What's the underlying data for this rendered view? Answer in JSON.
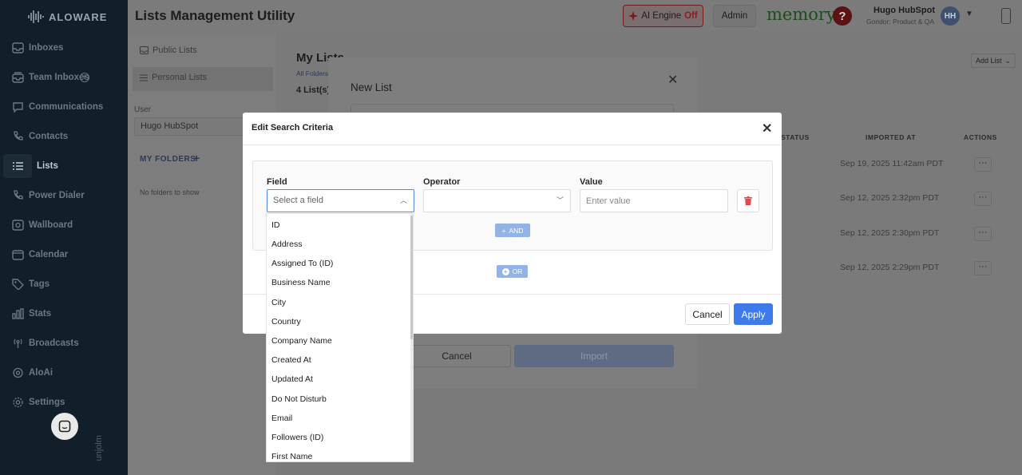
{
  "sidebar": {
    "logo": "ALOWARE",
    "items": [
      {
        "label": "Inboxes",
        "icon": "inbox-icon"
      },
      {
        "label": "Team Inboxes",
        "icon": "team-inbox-icon"
      },
      {
        "label": "Communications",
        "icon": "communications-icon"
      },
      {
        "label": "Contacts",
        "icon": "contacts-icon"
      },
      {
        "label": "Lists",
        "icon": "list-icon"
      },
      {
        "label": "Power Dialer",
        "icon": "power-dialer-icon"
      },
      {
        "label": "Wallboard",
        "icon": "wallboard-icon"
      },
      {
        "label": "Calendar",
        "icon": "calendar-icon"
      },
      {
        "label": "Tags",
        "icon": "tag-icon"
      },
      {
        "label": "Stats",
        "icon": "stats-icon"
      },
      {
        "label": "Broadcasts",
        "icon": "broadcast-icon"
      },
      {
        "label": "AloAi",
        "icon": "aloai-icon"
      },
      {
        "label": "Settings",
        "icon": "gear-icon"
      }
    ],
    "active_item": "Lists",
    "vertical_text": "unjolm"
  },
  "header": {
    "title": "Lists Management Utility",
    "ai_engine_label": "AI Engine",
    "ai_engine_status": "Off",
    "admin_label": "Admin",
    "memory_label": "memory",
    "help_label": "?",
    "user_name": "Hugo HubSpot",
    "user_sub": "Gondor: Product & QA",
    "avatar_initials": "HH"
  },
  "left_panel": {
    "public_lists": "Public Lists",
    "personal_lists": "Personal Lists",
    "user_label": "User",
    "user_value": "Hugo HubSpot",
    "my_folders": "MY FOLDERS",
    "no_folders": "No folders to show"
  },
  "main": {
    "title": "My Lists",
    "all_folders": "All Folders",
    "list_count": "4 List(s)",
    "add_list": "Add List",
    "columns": [
      "STATUS",
      "IMPORTED AT",
      "ACTIONS"
    ],
    "rows": [
      {
        "imported_at": "Sep 19, 2025 11:42am PDT"
      },
      {
        "imported_at": "Sep 12, 2025 2:32pm PDT"
      },
      {
        "imported_at": "Sep 12, 2025 2:30pm PDT"
      },
      {
        "imported_at": "Sep 12, 2025 2:29pm PDT"
      }
    ],
    "row_action_label": "···"
  },
  "new_list_modal": {
    "title": "New List",
    "cancel_label": "Cancel",
    "import_label": "Import"
  },
  "search_modal": {
    "title": "Edit Search Criteria",
    "field_label": "Field",
    "operator_label": "Operator",
    "value_label": "Value",
    "field_placeholder": "Select a field",
    "value_placeholder": "Enter value",
    "and_label": "AND",
    "or_label": "OR",
    "cancel_label": "Cancel",
    "apply_label": "Apply",
    "field_options": [
      "ID",
      "Address",
      "Assigned To (ID)",
      "Business Name",
      "City",
      "Country",
      "Company Name",
      "Created At",
      "Updated At",
      "Do Not Disturb",
      "Email",
      "Followers (ID)",
      "First Name"
    ]
  },
  "colors": {
    "sidebar_bg": "#121e2a",
    "accent_blue": "#3d7bed",
    "and_or_blue": "#93b3e6",
    "delete_red": "#e0484c"
  }
}
